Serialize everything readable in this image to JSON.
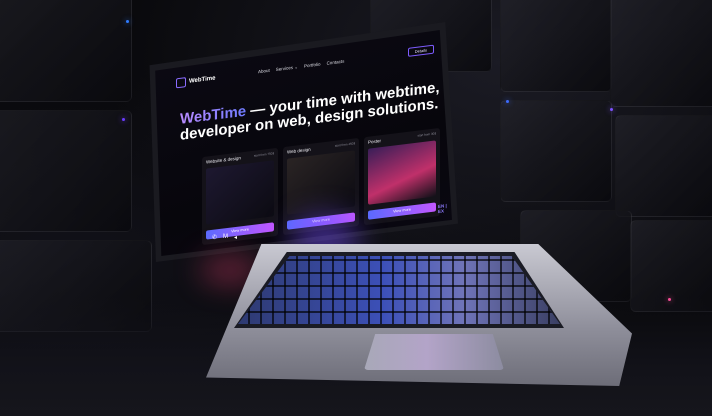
{
  "site": {
    "brand": "WebTime",
    "nav": [
      "About",
      "Services ⌄",
      "Portfolio",
      "Contacts"
    ],
    "cta": "Details",
    "hero": {
      "accent": "WebTime",
      "rest": " — your time with webtime, developer on web, design solutions."
    },
    "cards": [
      {
        "title": "Website & design",
        "sub": "start from 750$",
        "button": "View more"
      },
      {
        "title": "Web design",
        "sub": "start from 450$",
        "button": "View more"
      },
      {
        "title": "Poster",
        "sub": "start from 30$",
        "button": "View more"
      }
    ],
    "lang": "EN | EX",
    "socials": [
      "whatsapp-icon",
      "gmail-icon",
      "telegram-icon"
    ]
  },
  "colors": {
    "accent_purple": "#b98bff",
    "accent_blue": "#5a6bff",
    "accent_magenta": "#c257ff",
    "screen_bg": "#07060c"
  }
}
